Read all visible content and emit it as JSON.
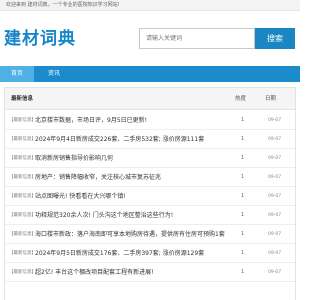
{
  "topbar": {
    "welcome": "欢迎来到 建材词典，一个专业的医院知识学习网站!"
  },
  "header": {
    "logo": "建材词典"
  },
  "search": {
    "placeholder": "请输入关键词",
    "button_label": "搜索"
  },
  "nav": {
    "items": [
      {
        "label": "首页",
        "active": true
      },
      {
        "label": "资讯",
        "active": false
      }
    ]
  },
  "list": {
    "title": "最新信息",
    "col_heat": "热度",
    "col_date": "日期",
    "rows": [
      {
        "tag": "【最新信息】",
        "title": "北京楼市数据，市场日评，9月5日已更新!",
        "heat": "1",
        "date": "09-07"
      },
      {
        "tag": "【最新信息】",
        "title": "2024年9月4日新房成交226套、二手房532套; 涨价房源111套",
        "heat": "1",
        "date": "09-07"
      },
      {
        "tag": "【最新信息】",
        "title": "取消新房销售指导价影响几何",
        "heat": "1",
        "date": "09-07"
      },
      {
        "tag": "【最新信息】",
        "title": "房地产：销售降幅收窄，关注核心城市复苏征兆",
        "heat": "1",
        "date": "09-07"
      },
      {
        "tag": "【最新信息】",
        "title": "站点图曝光! 快看看在大兴哪个镇!",
        "heat": "1",
        "date": "09-07"
      },
      {
        "tag": "【最新信息】",
        "title": "功释规范320余人次! 门头沟这个地区整治这些行为!",
        "heat": "1",
        "date": "09-07"
      },
      {
        "tag": "【最新信息】",
        "title": "海口楼市新政：落户海南即可享本地购房待遇，提供房有住房可预购1套",
        "heat": "1",
        "date": "09-07"
      },
      {
        "tag": "【最新信息】",
        "title": "2024年9月5日新房成交176套、二手房397套; 涨价房源129套",
        "heat": "1",
        "date": "09-07"
      },
      {
        "tag": "【最新信息】",
        "title": "超2亿! 丰台这个棚改项目配套工程有新进展!",
        "heat": "1",
        "date": "09-07"
      }
    ]
  }
}
